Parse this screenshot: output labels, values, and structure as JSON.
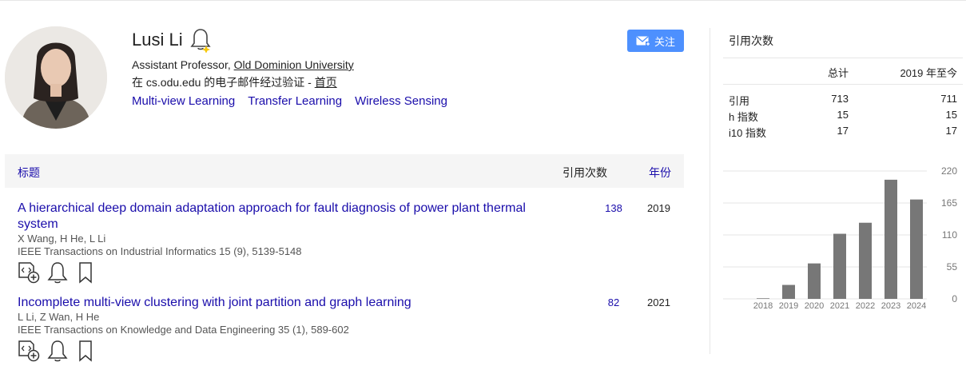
{
  "profile": {
    "name": "Lusi Li",
    "affiliation_prefix": "Assistant Professor, ",
    "affiliation_link": "Old Dominion University",
    "verified_text": "在 cs.odu.edu 的电子邮件经过验证 - ",
    "homepage_label": "首页",
    "interests": [
      "Multi-view Learning",
      "Transfer Learning",
      "Wireless Sensing"
    ],
    "follow_label": "关注"
  },
  "table": {
    "header_title": "标题",
    "header_cites": "引用次数",
    "header_year": "年份",
    "rows": [
      {
        "title": "A hierarchical deep domain adaptation approach for fault diagnosis of power plant thermal system",
        "authors": "X Wang, H He, L Li",
        "venue": "IEEE Transactions on Industrial Informatics 15 (9), 5139-5148",
        "cites": "138",
        "year": "2019"
      },
      {
        "title": "Incomplete multi-view clustering with joint partition and graph learning",
        "authors": "L Li, Z Wan, H He",
        "venue": "IEEE Transactions on Knowledge and Data Engineering 35 (1), 589-602",
        "cites": "82",
        "year": "2021"
      }
    ]
  },
  "sidebar": {
    "title": "引用次数",
    "col_total": "总计",
    "col_since": "2019 年至今",
    "stats": [
      {
        "label": "引用",
        "total": "713",
        "since": "711"
      },
      {
        "label": "h 指数",
        "total": "15",
        "since": "15"
      },
      {
        "label": "i10 指数",
        "total": "17",
        "since": "17"
      }
    ]
  },
  "colors": {
    "link": "#1a0dab",
    "follow_button": "#4d90fe",
    "bar": "#777777"
  },
  "chart_data": {
    "type": "bar",
    "categories": [
      "2018",
      "2019",
      "2020",
      "2021",
      "2022",
      "2023",
      "2024"
    ],
    "values": [
      1,
      24,
      61,
      112,
      131,
      205,
      171
    ],
    "ylim": [
      0,
      220
    ],
    "yticks": [
      "0",
      "55",
      "110",
      "165",
      "220"
    ],
    "grid": true
  }
}
